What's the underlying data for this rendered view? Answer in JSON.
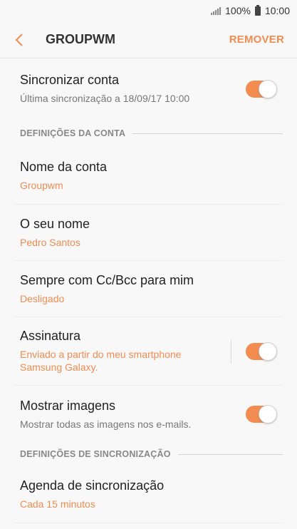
{
  "status_bar": {
    "battery_percent": "100%",
    "time": "10:00"
  },
  "app_bar": {
    "title": "GROUPWM",
    "action_label": "REMOVER"
  },
  "sync_account": {
    "label": "Sincronizar conta",
    "sub": "Última sincronização a 18/09/17  10:00",
    "toggle_on": true
  },
  "sections": {
    "account": "DEFINIÇÕES DA CONTA",
    "sync": "DEFINIÇÕES DE SINCRONIZAÇÃO"
  },
  "account_name": {
    "label": "Nome da conta",
    "value": "Groupwm"
  },
  "your_name": {
    "label": "O seu nome",
    "value": "Pedro Santos"
  },
  "cc_bcc": {
    "label": "Sempre com Cc/Bcc para mim",
    "value": "Desligado"
  },
  "signature": {
    "label": "Assinatura",
    "value": "Enviado a partir do meu smartphone Samsung Galaxy.",
    "toggle_on": true
  },
  "show_images": {
    "label": "Mostrar imagens",
    "sub": "Mostrar todas as imagens nos e-mails.",
    "toggle_on": true
  },
  "sync_schedule": {
    "label": "Agenda de sincronização",
    "value": "Cada 15 minutos"
  },
  "colors": {
    "accent": "#f28c51",
    "background": "#f8f8f8"
  }
}
